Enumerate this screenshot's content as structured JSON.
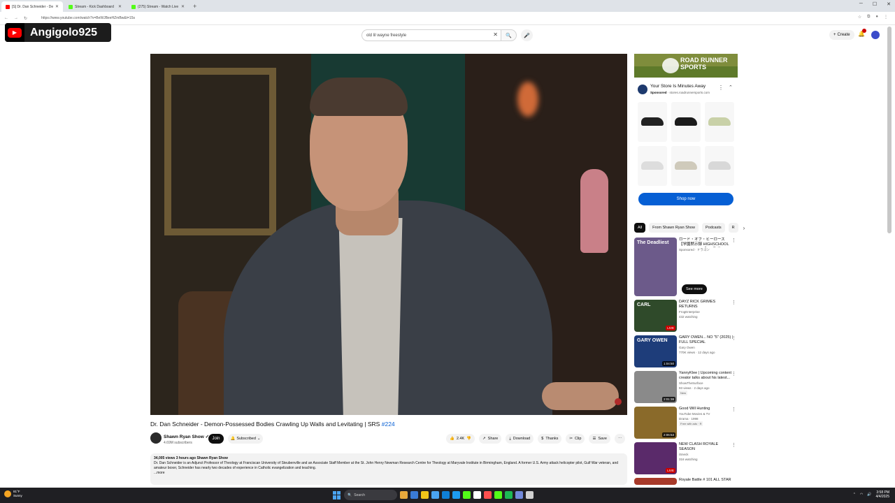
{
  "browser": {
    "tabs": [
      {
        "title": "[S] Dr. Dan Schneider - De",
        "active": true,
        "favicon": "youtube-icon"
      },
      {
        "title": "Stream - Kick Dashboard",
        "active": false,
        "favicon": "kick-icon"
      },
      {
        "title": "(275) Stream - Watch Live on Ki",
        "active": false,
        "favicon": "kick-icon"
      }
    ],
    "new_tab": "+",
    "url": "https://www.youtube.com/watch?v=BeWJBeeHZmBw&t=15s"
  },
  "overlay": {
    "channel_name": "Angigolo925"
  },
  "header": {
    "search_value": "old lil wayne freestyle",
    "create_label": "Create",
    "colors": {
      "accent": "#065fd4",
      "notification": "#cc0000"
    }
  },
  "video": {
    "title": "Dr. Dan Schneider - Demon-Possessed Bodies Crawling Up Walls and Levitating | SRS",
    "episode_tag": "#224",
    "channel": "Shawn Ryan Show",
    "verified_mark": "✓",
    "subscribers": "4.69M subscribers",
    "join_label": "Join",
    "subscribed_label": "Subscribed",
    "likes": "2.4K",
    "actions": {
      "share": "Share",
      "download": "Download",
      "thanks": "Thanks",
      "clip": "Clip",
      "save": "Save",
      "more": "⋯"
    },
    "description": {
      "views": "34,005 views",
      "age": "3 hours ago",
      "channel_tag": "Shawn Ryan Show",
      "text": "Dr. Dan Schneider is an Adjunct Professor of Theology at Franciscan University of Steubenville and an Associate Staff Member at the St. John Henry Newman Research Centre for Theology at Maryvale Institute in Birmingham, England. A former U.S. Army attack helicopter pilot, Gulf War veteran, and amateur boxer, Schneider has nearly two decades of experience in Catholic evangelization and teaching.",
      "more": "...more"
    }
  },
  "ad": {
    "brand_line1": "ROAD RUNNER",
    "brand_line2": "SPORTS",
    "title": "Your Store Is Minutes Away",
    "sponsored": "Sponsored",
    "domain": "stores.roadrunnersports.com",
    "cta": "Shop now",
    "shoe_colors": [
      "#222222",
      "#1b1b1b",
      "#c9d1a8",
      "#dddddd",
      "#cfcabb",
      "#d8d8d8"
    ]
  },
  "chips": [
    "All",
    "From Shawn Ryan Show",
    "Podcasts",
    "R"
  ],
  "recommendations": [
    {
      "title": "ロード・オブ・ヒーローズ 【学園黙示録 HIGHSCHOOL OF THE DEAD】コラボ",
      "channel": "Sponsored · ドラゴン",
      "meta": "",
      "badge": "",
      "thumb": "#6c5a8a",
      "height": 84,
      "cta": "See more",
      "overlay_text": "The Deadliest"
    },
    {
      "title": "DAYZ RICK GRIMES RETURNS",
      "channel": "FrogEnterprise",
      "meta": "432 watching",
      "badge": "LIVE",
      "thumb": "#2f4a2a",
      "height": 46,
      "overlay_text": "CARL"
    },
    {
      "title": "GARY OWEN... NO \"5\" (2025) | FULL SPECIAL",
      "channel": "Gary Owen",
      "meta": "770K views · 12 days ago",
      "badge": "1:04:50",
      "thumb": "#1e3d7a",
      "height": 46,
      "overlay_text": "GARY OWEN"
    },
    {
      "title": "YannyKlee | Upcoming content creator talks about his latest...",
      "channel": "ShowTheSurface",
      "meta": "93 views · 2 days ago",
      "badge": "2:01:38",
      "thumb": "#8a8a8a",
      "height": 46,
      "tag": "New"
    },
    {
      "title": "Good Will Hunting",
      "channel": "YouTube Movies & TV",
      "meta": "Drama · 1998",
      "badge": "2:06:53",
      "thumb": "#8a6a2a",
      "height": 46,
      "tag": "Free with ads · R"
    },
    {
      "title": "NEW CLASH ROYALE SEASON",
      "channel": "iSneck",
      "meta": "316 watching",
      "badge": "LIVE",
      "thumb": "#5a2a6a",
      "height": 46
    },
    {
      "title": "Royale Battle # 101 ALL STAR",
      "channel": "",
      "meta": "",
      "badge": "",
      "thumb": "#a83a2a",
      "height": 10
    }
  ],
  "taskbar": {
    "weather_temp": "81°F",
    "weather_desc": "Sunny",
    "search_placeholder": "Search",
    "time": "3:58 PM",
    "date": "4/4/2025",
    "app_colors": [
      "#e8a93c",
      "#3a7bd5",
      "#f0c419",
      "#4aa3f0",
      "#0f7fd6",
      "#1d9bf0",
      "#53fc18",
      "#ffffff",
      "#ff4f4f",
      "#53fc18",
      "#1db954",
      "#7289da",
      "#d0d0d0"
    ]
  }
}
